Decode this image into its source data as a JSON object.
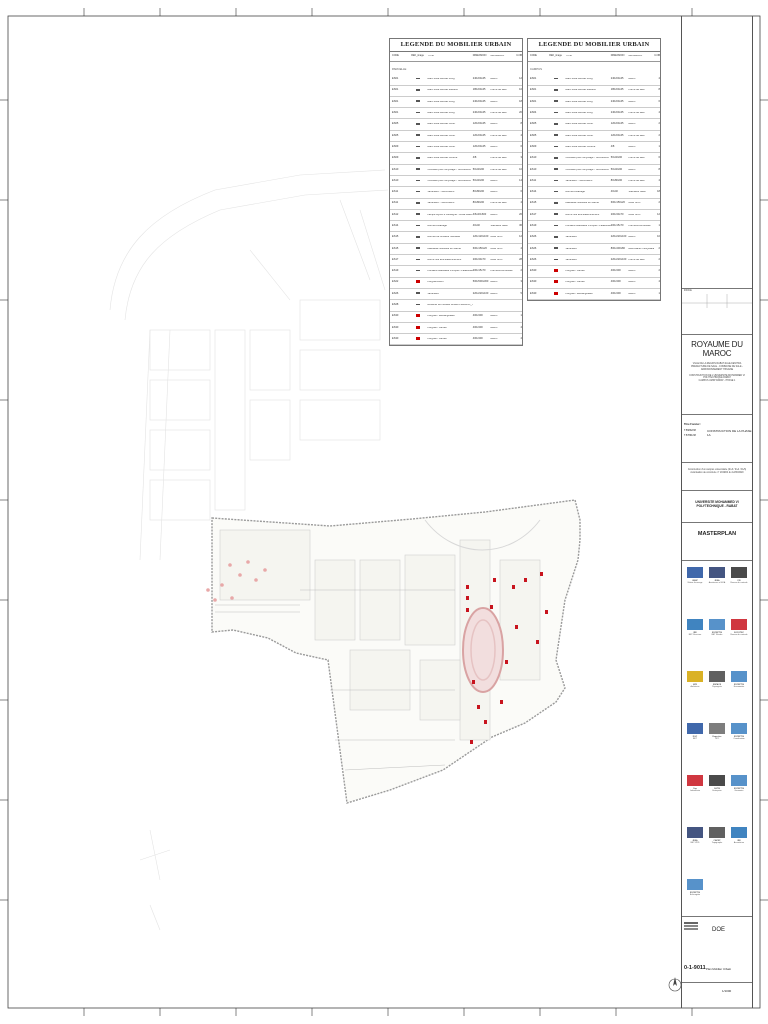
{
  "legend_tables": [
    {
      "title": "LEGENDE DU MOBILIER URBAIN",
      "columns": [
        "CODE",
        "REF_image",
        "TYPE",
        "DIMENSION",
        "MATERIAUX",
        "U.NB"
      ],
      "section": "PARCELLE",
      "rows": [
        {
          "code": "ES01",
          "type": "Banc lisse Bouvet Long",
          "dim": "240x60x45",
          "mat": "Beton",
          "qty": "12",
          "sym": "grey"
        },
        {
          "code": "ES01",
          "type": "Banc lisse Bouvet Medium",
          "dim": "180x60x45",
          "mat": "Pierre de taux",
          "qty": "16",
          "sym": "grey"
        },
        {
          "code": "ES01",
          "type": "Banc lisse Bouvet Long",
          "dim": "240x60x45",
          "mat": "Beton",
          "qty": "18",
          "sym": "grey"
        },
        {
          "code": "ES01",
          "type": "Banc lisse Bouvet Long",
          "dim": "240x60x45",
          "mat": "Pierre de taux",
          "qty": "20",
          "sym": "grey"
        },
        {
          "code": "ES05",
          "type": "Banc lisse Bouvet Court",
          "dim": "120x60x45",
          "mat": "Beton",
          "qty": "8",
          "sym": "grey"
        },
        {
          "code": "ES05",
          "type": "Banc lisse Bouvet Court",
          "dim": "120x60x45",
          "mat": "Pierre de taux",
          "qty": "4",
          "sym": "grey"
        },
        {
          "code": "ES09",
          "type": "Banc lisse Bouvet Court",
          "dim": "120x60x45",
          "mat": "Beton",
          "qty": "6",
          "sym": "grey"
        },
        {
          "code": "ES09",
          "type": "Banc lisse Bouvet Courbe",
          "dim": "4/8",
          "mat": "Pierre de taux",
          "qty": "3",
          "sym": "grey"
        },
        {
          "code": "ES10",
          "type": "Corbeille pour recyclage - Surcouvent",
          "dim": "50x40x90",
          "mat": "Pierre de taux",
          "qty": "10",
          "sym": "grey"
        },
        {
          "code": "ES10",
          "type": "Corbeille pour recyclage - Surcouvent",
          "dim": "50x40x90",
          "mat": "Beton",
          "qty": "14",
          "sym": "grey"
        },
        {
          "code": "ES11",
          "type": "Jardiniere - Surcouvent",
          "dim": "80x80x90",
          "mat": "Beton",
          "qty": "6",
          "sym": "grey"
        },
        {
          "code": "ES11",
          "type": "Jardiniere - Surcouvent",
          "dim": "80x80x90",
          "mat": "Pierre de taux",
          "qty": "4",
          "sym": "grey"
        },
        {
          "code": "ES12",
          "type": "Lampe Hydro d'Jouvegne - Rose Blanc",
          "dim": "4/6x20x600",
          "mat": "Beton",
          "qty": "26",
          "sym": "grey"
        },
        {
          "code": "ES14",
          "type": "Bornes eclairage",
          "dim": "40x40",
          "mat": "Stainless Steel",
          "qty": "36",
          "sym": "grey"
        },
        {
          "code": "ES15",
          "type": "Bornes de fontaine Nouvelle",
          "dim": "120x120x100",
          "mat": "Acier brun",
          "qty": "12",
          "sym": "grey"
        },
        {
          "code": "ES15",
          "type": "Habitable Nouvelle en Bleme",
          "dim": "600x150x20",
          "mat": "Acier brun",
          "qty": "4",
          "sym": "grey"
        },
        {
          "code": "ES17",
          "type": "Borne fixe anti-stationnement",
          "dim": "200x30x70",
          "mat": "Acier brun",
          "qty": "28",
          "sym": "grey"
        },
        {
          "code": "ES19",
          "type": "Fontaine Habitable Pompier + Elaboute",
          "dim": "200x15x70",
          "mat": "Pierre/verre/Suisse",
          "qty": "2",
          "sym": "grey"
        },
        {
          "code": "ES22",
          "type": "Pergola Bovin",
          "dim": "500x500x300",
          "mat": "Beton",
          "qty": "3",
          "sym": "red"
        },
        {
          "code": "ES26",
          "type": "Jardiniere",
          "dim": "220x220x100",
          "mat": "Beton",
          "qty": "5",
          "sym": "grey"
        },
        {
          "code": "ES28",
          "type": "Reverse du mobilier ES02/CSAIMOU_T3/mod2 ES04/Standard_Standout",
          "dim": "",
          "mat": "",
          "qty": "",
          "sym": "grey"
        },
        {
          "code": "ES30",
          "type": "Pergola - Rectangulaire",
          "dim": "400x300",
          "mat": "Beton",
          "qty": "1",
          "sym": "red"
        },
        {
          "code": "ES30",
          "type": "Pergola - Carree",
          "dim": "400x300",
          "mat": "Beton",
          "qty": "4",
          "sym": "red"
        },
        {
          "code": "ES30",
          "type": "Pergola - Carree",
          "dim": "400x300",
          "mat": "Beton",
          "qty": "4",
          "sym": "red"
        }
      ]
    },
    {
      "title": "LEGENDE DU MOBILIER URBAIN",
      "columns": [
        "CODE",
        "REF_image",
        "TYPE",
        "DIMENSION",
        "MATERIAUX",
        "U.NB"
      ],
      "section": "CAMPUS",
      "rows": [
        {
          "code": "ES01",
          "type": "Banc lisse Bouvet Long",
          "dim": "240x60x45",
          "mat": "Beton",
          "qty": "4",
          "sym": "grey"
        },
        {
          "code": "ES01",
          "type": "Banc lisse Bouvet Medium",
          "dim": "180x60x45",
          "mat": "Pierre de taux",
          "qty": "8",
          "sym": "grey"
        },
        {
          "code": "ES01",
          "type": "Banc lisse Bouvet Long",
          "dim": "240x60x45",
          "mat": "Beton",
          "qty": "6",
          "sym": "grey"
        },
        {
          "code": "ES04",
          "type": "Banc lisse Bouvet Long",
          "dim": "240x60x45",
          "mat": "Pierre de taux",
          "qty": "4",
          "sym": "grey"
        },
        {
          "code": "ES05",
          "type": "Banc lisse Bouvet Court",
          "dim": "120x60x45",
          "mat": "Beton",
          "qty": "2",
          "sym": "grey"
        },
        {
          "code": "ES05",
          "type": "Banc lisse Bouvet Court",
          "dim": "120x60x45",
          "mat": "Pierre de taux",
          "qty": "2",
          "sym": "grey"
        },
        {
          "code": "ES09",
          "type": "Banc lisse Bouvet Courbe",
          "dim": "4/8",
          "mat": "Beton",
          "qty": "1",
          "sym": "grey"
        },
        {
          "code": "ES10",
          "type": "Corbeille pour recyclage - Surcouvent",
          "dim": "50x40x90",
          "mat": "Pierre de taux",
          "qty": "6",
          "sym": "grey"
        },
        {
          "code": "ES10",
          "type": "Corbeille pour recyclage - Surcouvent",
          "dim": "50x40x90",
          "mat": "Beton",
          "qty": "8",
          "sym": "grey"
        },
        {
          "code": "ES11",
          "type": "Jardiniere - Surcouvent",
          "dim": "80x80x90",
          "mat": "Pierre de taux",
          "qty": "4",
          "sym": "grey"
        },
        {
          "code": "ES14",
          "type": "Bornes eclairage",
          "dim": "40x40",
          "mat": "Stainless Steel",
          "qty": "18",
          "sym": "grey"
        },
        {
          "code": "ES15",
          "type": "Habitable Nouvelle en Bleme",
          "dim": "600x150x20",
          "mat": "Acier brun",
          "qty": "2",
          "sym": "grey"
        },
        {
          "code": "ES17",
          "type": "Borne fixe anti-stationnement",
          "dim": "200x30x70",
          "mat": "Acier brun",
          "qty": "12",
          "sym": "grey"
        },
        {
          "code": "ES19",
          "type": "Fontaine Habitable Pompier + Elaboute",
          "dim": "200x15x70",
          "mat": "Pierre/verre/Suisse",
          "qty": "1",
          "sym": "grey"
        },
        {
          "code": "ES26",
          "type": "Jardiniere",
          "dim": "220x220x100",
          "mat": "Beton",
          "qty": "10",
          "sym": "grey"
        },
        {
          "code": "ES26",
          "type": "Jardiniere",
          "dim": "800x400x80",
          "mat": "Beton/acier Inoxydable",
          "qty": "2",
          "sym": "grey"
        },
        {
          "code": "ES26",
          "type": "Jardiniere",
          "dim": "220x220x100",
          "mat": "Pierre de taux",
          "qty": "2",
          "sym": "grey"
        },
        {
          "code": "ES30",
          "type": "Pergola - Carree",
          "dim": "400x300",
          "mat": "Beton",
          "qty": "2",
          "sym": "red"
        },
        {
          "code": "ES30",
          "type": "Pergola - Carree",
          "dim": "400x300",
          "mat": "Beton",
          "qty": "4",
          "sym": "red"
        },
        {
          "code": "ES30",
          "type": "Pergola - Rectangulaire",
          "dim": "400x300",
          "mat": "Beton",
          "qty": "1",
          "sym": "red"
        }
      ]
    }
  ],
  "title_block": {
    "revision_label": "INDICE",
    "country": "ROYAUME DU MAROC",
    "region_lines": [
      "VILLE DE LA REGION RABAT-SALE-KENITRA",
      "PREFECTURE DE SALE - COMMUNE DE SALE - ARRONDISSEMENT HSSAINE",
      "CONSTRUCTION DE L'UNIVERSITE MOHAMMED VI POLYTECHNIQUE RABAT",
      "CAMPUS UM6P RABAT - PHASE 1"
    ],
    "phase_label": "Titre Foncier :",
    "phase_refs": [
      "T.56832/38",
      "T.57891/38"
    ],
    "phase_title": "CONSTRUCTION DE LA PHASE 1A",
    "permit_lines": [
      "Construction d'un campus universitaire (R+3 / R+4 / R+5)",
      "Autorisation de construire n° 2019/04 du 12/06/2020"
    ],
    "client": "UNIVERSITE MOHAMMED VI POLYTECHNIQUE - RABAT",
    "drawing_title": "MASTERPLAN",
    "partners": [
      {
        "name": "UM6P",
        "role": "Maitre d'ouvrage"
      },
      {
        "name": "JESA",
        "role": "Assistance a MOA"
      },
      {
        "name": "CID",
        "role": "Bureau de controle"
      },
      {
        "name": "IRE",
        "role": "BET Structure"
      },
      {
        "name": "EXCEPTIS",
        "role": "BET Fluides"
      },
      {
        "name": "SOCOTEC",
        "role": "Bureau de controle"
      },
      {
        "name": "ATE",
        "role": "Architecte"
      },
      {
        "name": "ESPACE",
        "role": "Paysagiste"
      },
      {
        "name": "EXCEPTIS",
        "role": "Economiste"
      },
      {
        "name": "DGC",
        "role": "BET"
      },
      {
        "name": "Expertise",
        "role": "OPC"
      },
      {
        "name": "EXCEPTIS",
        "role": "Coordination"
      },
      {
        "name": "Cap",
        "role": "Laboratoire"
      },
      {
        "name": "SGTM",
        "role": "Entreprise"
      },
      {
        "name": "EXCEPTIS",
        "role": "Geometre"
      },
      {
        "name": "JESA",
        "role": "BET VRD"
      },
      {
        "name": "CAPEP",
        "role": "Topographe"
      },
      {
        "name": "IRE",
        "role": "Acousticien"
      },
      {
        "name": "EXCEPTIS",
        "role": "Eclairagiste"
      }
    ],
    "stage": "DOE",
    "sheet_number": "0-1-9011",
    "sheet_title": "Plan Mobilier Urbain",
    "scale": "1/1000"
  },
  "colors": {
    "accent_red": "#c8141e",
    "linework": "#bdbdbd",
    "frame": "#555555"
  }
}
